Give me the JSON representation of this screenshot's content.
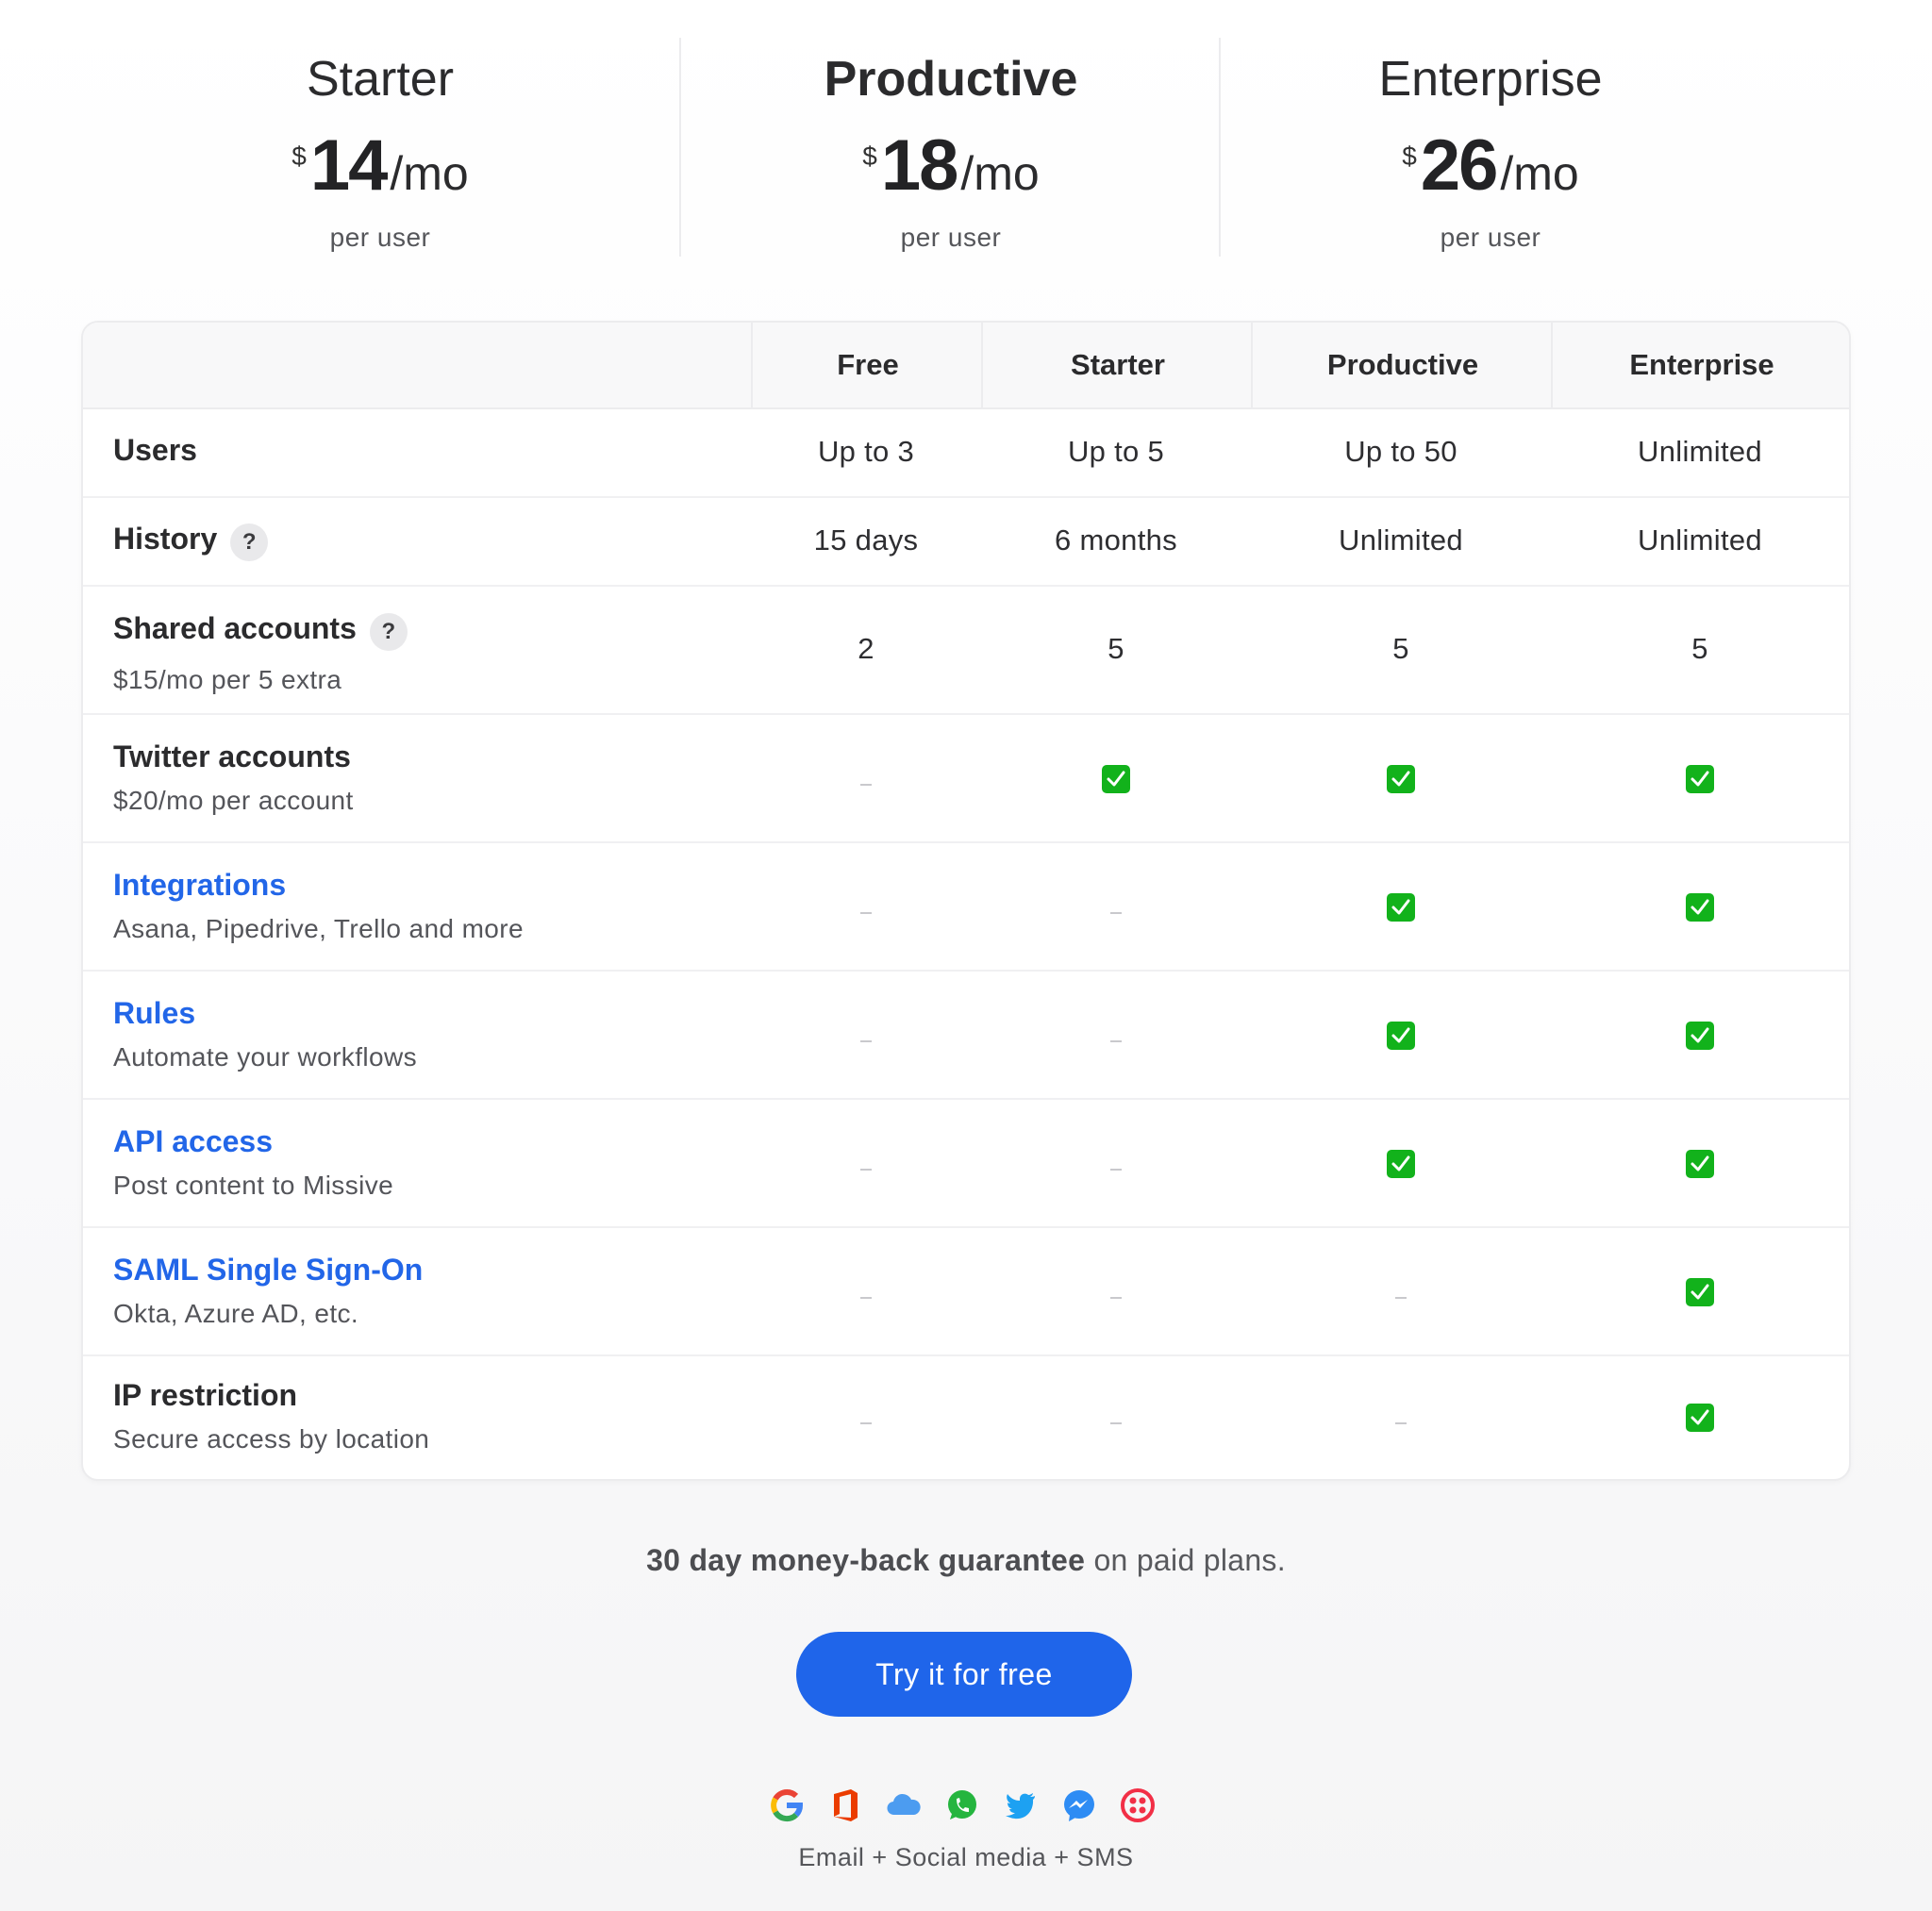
{
  "plans_header": [
    {
      "name": "Starter",
      "currency": "$",
      "amount": "14",
      "period": "/mo",
      "per": "per user",
      "featured": false
    },
    {
      "name": "Productive",
      "currency": "$",
      "amount": "18",
      "period": "/mo",
      "per": "per user",
      "featured": true
    },
    {
      "name": "Enterprise",
      "currency": "$",
      "amount": "26",
      "period": "/mo",
      "per": "per user",
      "featured": false
    }
  ],
  "table": {
    "columns": [
      "Free",
      "Starter",
      "Productive",
      "Enterprise"
    ],
    "rows": [
      {
        "title": "Users",
        "subtitle": "",
        "link": false,
        "help": false,
        "values": [
          "Up to 3",
          "Up to 5",
          "Up to 50",
          "Unlimited"
        ]
      },
      {
        "title": "History",
        "subtitle": "",
        "link": false,
        "help": true,
        "values": [
          "15 days",
          "6 months",
          "Unlimited",
          "Unlimited"
        ]
      },
      {
        "title": "Shared accounts",
        "subtitle": "$15/mo per 5 extra",
        "link": false,
        "help": true,
        "values": [
          "2",
          "5",
          "5",
          "5"
        ]
      },
      {
        "title": "Twitter accounts",
        "subtitle": "$20/mo per account",
        "link": false,
        "help": false,
        "values": [
          false,
          true,
          true,
          true
        ]
      },
      {
        "title": "Integrations",
        "subtitle": "Asana, Pipedrive, Trello and more",
        "link": true,
        "help": false,
        "values": [
          false,
          false,
          true,
          true
        ]
      },
      {
        "title": "Rules",
        "subtitle": "Automate your workflows",
        "link": true,
        "help": false,
        "values": [
          false,
          false,
          true,
          true
        ]
      },
      {
        "title": "API access",
        "subtitle": "Post content to Missive",
        "link": true,
        "help": false,
        "values": [
          false,
          false,
          true,
          true
        ]
      },
      {
        "title": "SAML Single Sign-On",
        "subtitle": "Okta, Azure AD, etc.",
        "link": true,
        "help": false,
        "values": [
          false,
          false,
          false,
          true
        ]
      },
      {
        "title": "IP restriction",
        "subtitle": "Secure access by location",
        "link": false,
        "help": false,
        "values": [
          false,
          false,
          false,
          true
        ]
      }
    ],
    "help_symbol": "?"
  },
  "footer": {
    "guarantee_bold": "30 day money-back guarantee",
    "guarantee_rest": " on paid plans.",
    "cta_label": "Try it for free",
    "channels": [
      "google-icon",
      "office-icon",
      "icloud-icon",
      "whatsapp-icon",
      "twitter-icon",
      "messenger-icon",
      "twilio-icon"
    ],
    "channels_caption": "Email + Social media + SMS"
  },
  "colors": {
    "accent": "#1f65ea",
    "link": "#2266e8",
    "check": "#12b21b"
  }
}
